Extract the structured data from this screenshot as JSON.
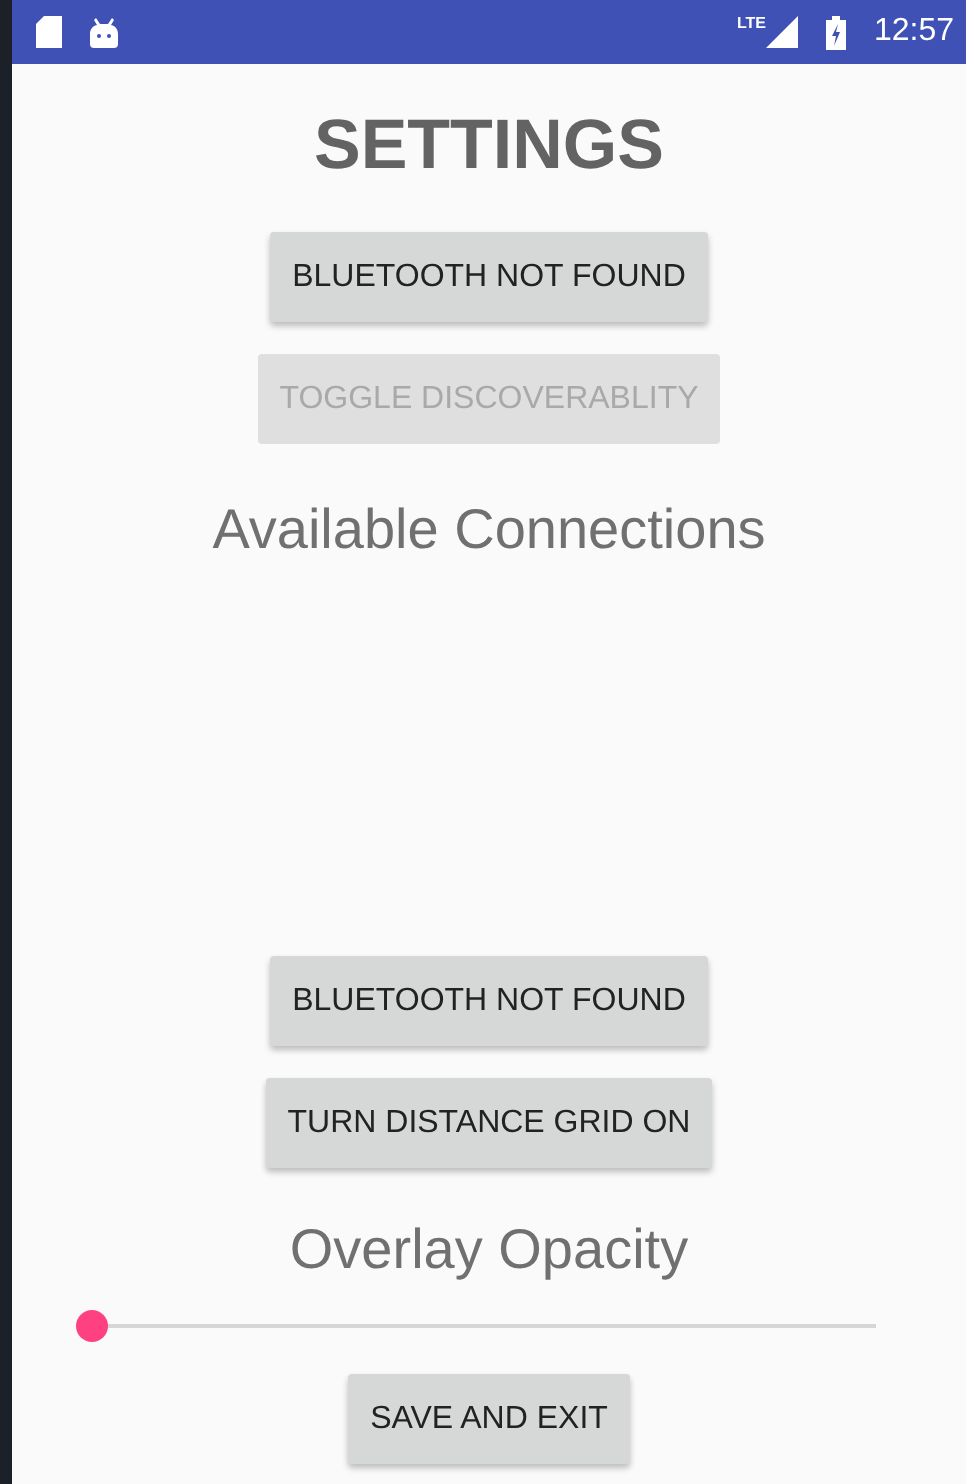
{
  "status_bar": {
    "time": "12:57",
    "network": "LTE"
  },
  "title": "SETTINGS",
  "bluetooth_button": {
    "label": "BLUETOOTH NOT FOUND",
    "disabled": false
  },
  "discoverability_button": {
    "label": "TOGGLE DISCOVERABLITY",
    "disabled": true
  },
  "connections_heading": "Available Connections",
  "bottom_buttons": [
    {
      "label": "BLUETOOTH NOT FOUND",
      "disabled": false
    },
    {
      "label": "TURN DISTANCE GRID ON",
      "disabled": false
    }
  ],
  "opacity_label": "Overlay Opacity",
  "opacity_slider": {
    "level": 0
  },
  "save_button": {
    "label": "SAVE AND EXIT",
    "disabled": false
  }
}
